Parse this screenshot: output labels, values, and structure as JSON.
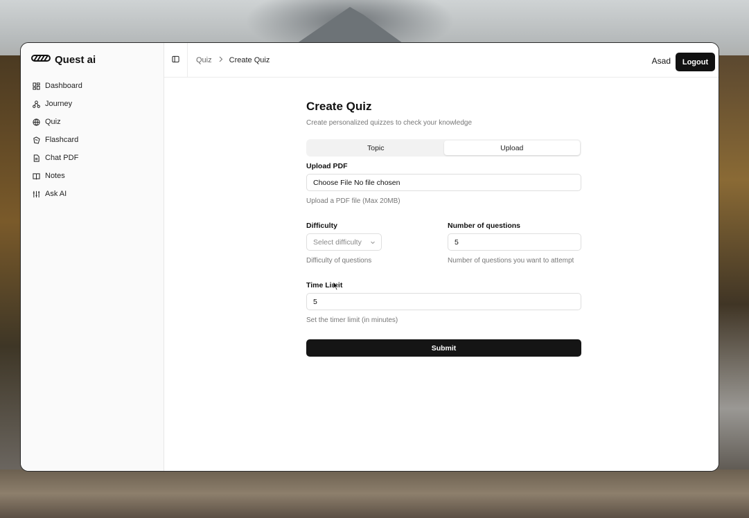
{
  "app": {
    "name": "Quest ai"
  },
  "sidebar": {
    "items": [
      {
        "label": "Dashboard",
        "icon": "dashboard-icon"
      },
      {
        "label": "Journey",
        "icon": "journey-icon"
      },
      {
        "label": "Quiz",
        "icon": "quiz-icon"
      },
      {
        "label": "Flashcard",
        "icon": "flashcard-icon"
      },
      {
        "label": "Chat PDF",
        "icon": "document-icon"
      },
      {
        "label": "Notes",
        "icon": "book-icon"
      },
      {
        "label": "Ask AI",
        "icon": "sliders-icon"
      }
    ]
  },
  "breadcrumb": {
    "parent": "Quiz",
    "current": "Create Quiz"
  },
  "header": {
    "user_name": "Asad",
    "logout_label": "Logout"
  },
  "page": {
    "title": "Create Quiz",
    "subtitle": "Create personalized quizzes to check your knowledge"
  },
  "tabs": [
    {
      "label": "Topic",
      "active": false
    },
    {
      "label": "Upload",
      "active": true
    }
  ],
  "form": {
    "upload": {
      "label": "Upload PDF",
      "value": "Choose File No file chosen",
      "help": "Upload a PDF file (Max 20MB)"
    },
    "difficulty": {
      "label": "Difficulty",
      "placeholder": "Select difficulty",
      "help": "Difficulty of questions"
    },
    "num_questions": {
      "label": "Number of questions",
      "value": "5",
      "help": "Number of questions you want to attempt"
    },
    "time_limit": {
      "label": "Time Limit",
      "value": "5",
      "help": "Set the timer limit (in minutes)"
    },
    "submit_label": "Submit"
  },
  "colors": {
    "primary": "#111111",
    "muted_text": "#777777",
    "border": "#dedede"
  }
}
